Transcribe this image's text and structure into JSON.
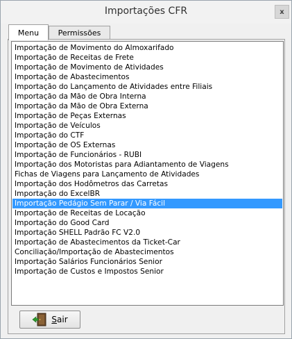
{
  "window": {
    "title": "Importações CFR",
    "close_label": "x"
  },
  "tabs": [
    {
      "label": "Menu",
      "active": true
    },
    {
      "label": "Permissões",
      "active": false
    }
  ],
  "list": {
    "items": [
      "Importação de Movimento do Almoxarifado",
      "Importação de Receitas de Frete",
      "Importação de Movimento de Atividades",
      "Importação de Abastecimentos",
      "Importação do Lançamento de Atividades entre Filiais",
      "Importação da Mão de Obra Interna",
      "Importação da Mão de Obra Externa",
      "Importação de Peças Externas",
      "Importação de Veículos",
      "Importação do CTF",
      "Importação de OS Externas",
      "Importação de Funcionários - RUBI",
      "Importação dos Motoristas para Adiantamento de Viagens",
      "Fichas de Viagens para Lançamento de Atividades",
      "Importação dos Hodômetros das Carretas",
      "Importação do ExcelBR",
      "Importação Pedágio Sem Parar / Via Fácil",
      "Importação de Receitas de Locação",
      "Importação do Good Card",
      "Importação SHELL Padrão FC V2.0",
      "Importação de Abastecimentos da Ticket-Car",
      "Conciliação/Importação de Abastecimentos",
      "Importação Salários Funcionários Senior",
      "Importação de Custos e Impostos Senior"
    ],
    "selected_index": 16
  },
  "footer": {
    "exit_label": "Sair",
    "exit_icon": "exit-door-icon"
  },
  "colors": {
    "selection": "#3399ff",
    "window_bg": "#f0f0f0"
  }
}
